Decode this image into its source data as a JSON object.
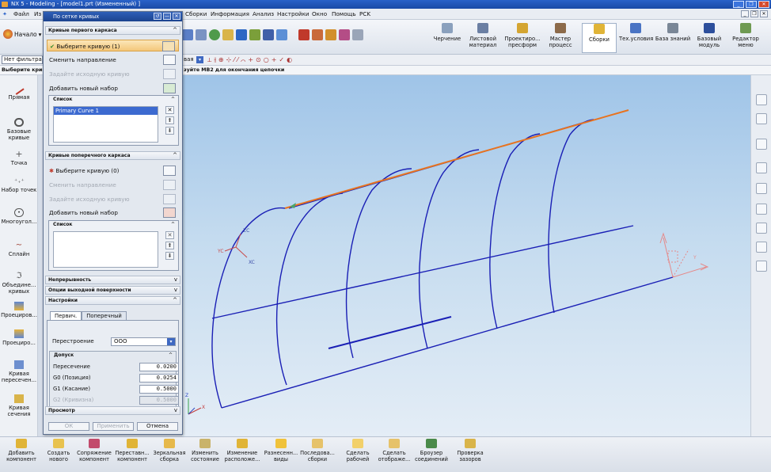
{
  "window": {
    "title": "NX 5 - Modeling - [model1.prt (Измененный) ]"
  },
  "menu": {
    "items": [
      "Файл",
      "Из",
      "Сборки",
      "Информация",
      "Анализ",
      "Настройки",
      "Окно",
      "Помощь",
      "PCK"
    ]
  },
  "ribbon": {
    "start_label": "Начало",
    "apps": [
      {
        "label": "Черчение",
        "icon": "drafting-icon"
      },
      {
        "label": "Листовой материал",
        "icon": "sheet-metal-icon"
      },
      {
        "label": "Проектиро... пресформ",
        "icon": "mold-design-icon"
      },
      {
        "label": "Мастер процесс",
        "icon": "process-wizard-icon"
      },
      {
        "label": "Сборки",
        "icon": "assemblies-icon",
        "active": true
      },
      {
        "label": "Тех.условия",
        "icon": "specs-icon"
      },
      {
        "label": "База знаний",
        "icon": "knowledge-icon"
      },
      {
        "label": "Базовый модуль",
        "icon": "gateway-icon"
      },
      {
        "label": "Редактор меню",
        "icon": "menu-editor-icon"
      }
    ]
  },
  "selection_bar": {
    "filter": "Нет фильтра",
    "mode_label": "вая"
  },
  "cue_line": {
    "left": "Выберите кривы",
    "right": "зуйте MB2 для окончания цепочки"
  },
  "left_toolbar": {
    "items": [
      {
        "label": "Прямая",
        "icon": "line-icon"
      },
      {
        "label": "Базовые кривые",
        "icon": "basic-curves-icon"
      },
      {
        "label": "Точка",
        "icon": "point-icon"
      },
      {
        "label": "Набор точек",
        "icon": "point-set-icon"
      },
      {
        "label": "Многоугол...",
        "icon": "polygon-icon"
      },
      {
        "label": "Сплайн",
        "icon": "spline-icon"
      },
      {
        "label": "Объедине... кривых",
        "icon": "join-curves-icon"
      },
      {
        "label": "Проециров...",
        "icon": "project-icon"
      },
      {
        "label": "Проециро...",
        "icon": "project2-icon"
      },
      {
        "label": "Кривая пересечен...",
        "icon": "intersection-curve-icon"
      },
      {
        "label": "Кривая сечения",
        "icon": "section-curve-icon"
      }
    ]
  },
  "dialog": {
    "title": "По сетке кривых",
    "primary_section": "Кривые первого каркаса",
    "select_curve": "Выберите кривую (1)",
    "reverse": "Сменить направление",
    "start_curve": "Задайте исходную кривую",
    "add_set": "Добавить новый набор",
    "list_header": "Список",
    "primary_list": [
      "Primary Curve  1"
    ],
    "cross_section": "Кривые поперечного каркаса",
    "select_curve_cross": "Выберите кривую (0)",
    "reverse_cross": "Сменить направление",
    "start_curve_cross": "Задайте исходную кривую",
    "add_set_cross": "Добавить новый набор",
    "list_header_cross": "Список",
    "continuity": "Непрерывность",
    "output_options": "Опции выходной поверхности",
    "settings": "Настройки",
    "tab_primary": "Первич.",
    "tab_cross": "Поперечный",
    "rebuild_label": "Перестроение",
    "rebuild_value": "ООО",
    "tolerance_header": "Допуск",
    "fields": [
      {
        "label": "Пересечение",
        "value": "0.0200",
        "disabled": false
      },
      {
        "label": "G0 (Позиция)",
        "value": "0.0254",
        "disabled": false
      },
      {
        "label": "G1 (Касание)",
        "value": "0.5000",
        "disabled": false
      },
      {
        "label": "G2 (Кривизна)",
        "value": "0.5000",
        "disabled": true
      }
    ],
    "preview": "Просмотр",
    "ok": "ОК",
    "apply": "Применить",
    "cancel": "Отмена"
  },
  "bottom_toolbar": {
    "items": [
      {
        "label": "Добавить компонент",
        "icon": "add-component-icon"
      },
      {
        "label": "Создать нового",
        "icon": "create-new-icon"
      },
      {
        "label": "Сопряжение компонент",
        "icon": "mate-icon"
      },
      {
        "label": "Переставн... компонент",
        "icon": "reposition-icon"
      },
      {
        "label": "Зеркальная сборка",
        "icon": "mirror-assembly-icon"
      },
      {
        "label": "Изменить состояние",
        "icon": "change-state-icon"
      },
      {
        "label": "Изменение расположе...",
        "icon": "arrangement-icon"
      },
      {
        "label": "Разнесенн... виды",
        "icon": "exploded-views-icon"
      },
      {
        "label": "Последова... сборки",
        "icon": "sequence-icon"
      },
      {
        "label": "Сделать рабочей",
        "icon": "make-work-icon"
      },
      {
        "label": "Сделать отображе...",
        "icon": "make-displayed-icon"
      },
      {
        "label": "Броузер соединений",
        "icon": "connection-browser-icon"
      },
      {
        "label": "Проверка зазоров",
        "icon": "clearance-icon"
      }
    ]
  },
  "viewport": {
    "labels": {
      "xc": "XC",
      "zc": "ZC",
      "yc": "YC",
      "z": "Z",
      "x": "X",
      "y": "Y"
    },
    "colors": {
      "wire": "#1a1fb5",
      "highlight": "#e8731f",
      "background_top": "#9fc4e8"
    }
  }
}
